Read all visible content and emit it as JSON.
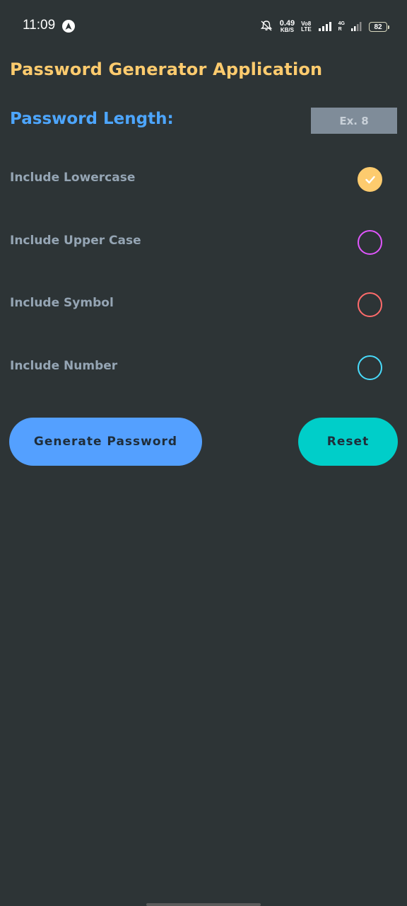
{
  "status_bar": {
    "time": "11:09",
    "speed_value": "0.49",
    "speed_unit": "KB/S",
    "volte_top": "Vo8",
    "volte_bottom": "LTE",
    "network_label_top": "4G",
    "network_label_bottom": "R",
    "battery": "82"
  },
  "app": {
    "title": "Password Generator Application",
    "length_label": "Password Length:",
    "length_input": {
      "value": "",
      "placeholder": "Ex. 8"
    },
    "options": [
      {
        "label": "Include Lowercase",
        "checked": true,
        "color": "#fdcb6e"
      },
      {
        "label": "Include Upper Case",
        "checked": false,
        "color": "#e056fd"
      },
      {
        "label": "Include Symbol",
        "checked": false,
        "color": "#ff6b6b"
      },
      {
        "label": "Include Number",
        "checked": false,
        "color": "#48dbfb"
      }
    ],
    "generate_label": "Generate Password",
    "reset_label": "Reset"
  },
  "colors": {
    "background": "#2d3436",
    "title": "#fdcb6e",
    "length_label": "#4da6ff",
    "generate_button": "#54a0ff",
    "reset_button": "#00cec9"
  }
}
